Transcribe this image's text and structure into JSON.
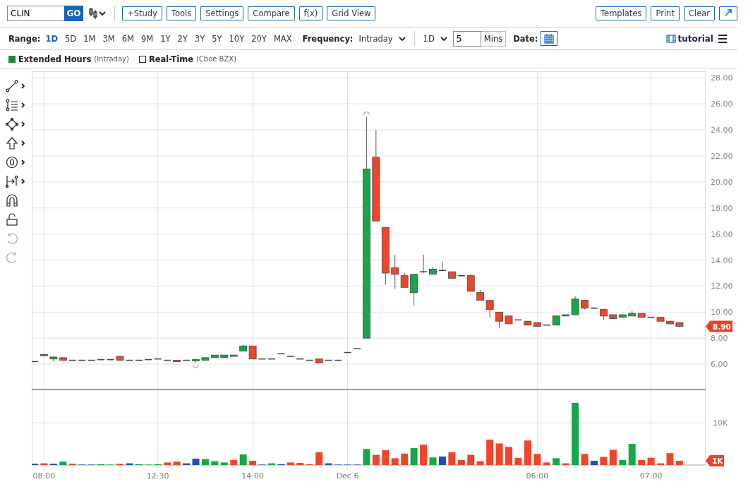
{
  "toolbar": {
    "symbol": "CLIN",
    "go": "GO",
    "buttons_left": [
      "+Study",
      "Tools",
      "Settings",
      "Compare",
      "f(x)",
      "Grid View"
    ],
    "buttons_right": [
      "Templates",
      "Print",
      "Clear"
    ]
  },
  "range": {
    "label": "Range:",
    "items": [
      {
        "label": "1D",
        "selected": true
      },
      {
        "label": "5D",
        "selected": false
      },
      {
        "label": "1M",
        "selected": false
      },
      {
        "label": "3M",
        "selected": false
      },
      {
        "label": "6M",
        "selected": false
      },
      {
        "label": "9M",
        "selected": false
      },
      {
        "label": "1Y",
        "selected": false
      },
      {
        "label": "2Y",
        "selected": false
      },
      {
        "label": "3Y",
        "selected": false
      },
      {
        "label": "5Y",
        "selected": false
      },
      {
        "label": "10Y",
        "selected": false
      },
      {
        "label": "20Y",
        "selected": false
      },
      {
        "label": "MAX",
        "selected": false
      }
    ]
  },
  "frequency": {
    "label": "Frequency:",
    "value": "Intraday"
  },
  "interval": {
    "value": "1D",
    "count": "5",
    "unit": "Mins"
  },
  "date": {
    "label": "Date:"
  },
  "tutorial": "tutorial",
  "legend": [
    {
      "label": "Extended Hours",
      "note": "(Intraday)",
      "checked": true
    },
    {
      "label": "Real-Time",
      "note": "(Cboe BZX)",
      "checked": false
    }
  ],
  "price_chart": {
    "last_price": "8.90",
    "chart_data": {
      "type": "candlestick",
      "grid": true,
      "ohlc": [
        [
          6.2,
          6.2,
          6.2,
          6.2
        ],
        [
          6.65,
          6.8,
          6.6,
          6.75
        ],
        [
          6.4,
          6.6,
          6.2,
          6.55
        ],
        [
          6.5,
          6.5,
          6.3,
          6.3
        ],
        [
          6.3,
          6.3,
          6.3,
          6.3
        ],
        [
          6.3,
          6.3,
          6.3,
          6.3
        ],
        [
          6.3,
          6.3,
          6.3,
          6.3
        ],
        [
          6.3,
          6.4,
          6.3,
          6.35
        ],
        [
          6.35,
          6.4,
          6.3,
          6.35
        ],
        [
          6.6,
          6.6,
          6.3,
          6.3
        ],
        [
          6.3,
          6.3,
          6.3,
          6.3
        ],
        [
          6.3,
          6.3,
          6.3,
          6.3
        ],
        [
          6.35,
          6.35,
          6.35,
          6.35
        ],
        [
          6.4,
          6.4,
          6.4,
          6.4
        ],
        [
          6.3,
          6.3,
          6.3,
          6.3
        ],
        [
          6.3,
          6.3,
          6.2,
          6.2
        ],
        [
          6.3,
          6.3,
          6.3,
          6.3
        ],
        [
          6.25,
          6.4,
          6.1,
          6.35
        ],
        [
          6.3,
          6.5,
          6.3,
          6.5
        ],
        [
          6.5,
          6.7,
          6.5,
          6.7
        ],
        [
          6.5,
          6.7,
          6.5,
          6.7
        ],
        [
          6.6,
          6.7,
          6.6,
          6.7
        ],
        [
          7.0,
          7.5,
          7.0,
          7.4
        ],
        [
          7.4,
          7.4,
          6.4,
          6.4
        ],
        [
          6.4,
          6.4,
          6.4,
          6.4
        ],
        [
          6.4,
          6.4,
          6.4,
          6.4
        ],
        [
          6.8,
          6.8,
          6.8,
          6.8
        ],
        [
          6.6,
          6.6,
          6.6,
          6.6
        ],
        [
          6.4,
          6.4,
          6.4,
          6.4
        ],
        [
          6.3,
          6.3,
          6.3,
          6.3
        ],
        [
          6.4,
          6.4,
          6.1,
          6.1
        ],
        [
          6.3,
          6.3,
          6.3,
          6.3
        ],
        [
          6.3,
          6.3,
          6.3,
          6.3
        ],
        [
          6.9,
          6.9,
          6.9,
          6.9
        ],
        [
          7.2,
          7.2,
          7.2,
          7.2
        ],
        [
          8.0,
          25.0,
          8.0,
          21.0
        ],
        [
          21.9,
          24.0,
          17.0,
          17.0
        ],
        [
          16.5,
          16.5,
          12.1,
          13.0
        ],
        [
          13.4,
          14.4,
          11.8,
          12.9
        ],
        [
          12.8,
          13.0,
          11.9,
          11.9
        ],
        [
          11.5,
          12.9,
          10.5,
          12.9
        ],
        [
          13.1,
          14.4,
          13.0,
          13.1
        ],
        [
          12.9,
          13.5,
          12.9,
          13.3
        ],
        [
          13.2,
          13.9,
          13.2,
          13.2
        ],
        [
          13.1,
          13.1,
          12.6,
          12.6
        ],
        [
          12.8,
          12.8,
          12.7,
          12.8
        ],
        [
          12.8,
          12.9,
          11.6,
          11.6
        ],
        [
          11.5,
          11.7,
          10.9,
          10.9
        ],
        [
          10.9,
          10.9,
          9.6,
          10.2
        ],
        [
          10.0,
          10.0,
          8.8,
          9.3
        ],
        [
          9.7,
          9.7,
          9.1,
          9.1
        ],
        [
          9.4,
          9.4,
          9.4,
          9.4
        ],
        [
          9.3,
          9.3,
          9.0,
          9.0
        ],
        [
          9.2,
          9.2,
          8.9,
          8.9
        ],
        [
          9.0,
          9.0,
          9.0,
          9.0
        ],
        [
          9.0,
          9.7,
          9.0,
          9.7
        ],
        [
          9.7,
          9.8,
          9.7,
          9.8
        ],
        [
          9.8,
          11.2,
          9.8,
          11.0
        ],
        [
          10.9,
          10.9,
          10.2,
          10.3
        ],
        [
          10.3,
          10.4,
          10.3,
          10.3
        ],
        [
          10.2,
          10.2,
          9.4,
          9.7
        ],
        [
          9.8,
          9.8,
          9.5,
          9.5
        ],
        [
          9.6,
          9.8,
          9.6,
          9.8
        ],
        [
          9.7,
          10.1,
          9.7,
          9.9
        ],
        [
          9.9,
          9.9,
          9.6,
          9.6
        ],
        [
          9.6,
          9.6,
          9.6,
          9.6
        ],
        [
          9.6,
          9.6,
          9.3,
          9.3
        ],
        [
          9.3,
          9.3,
          9.0,
          9.1
        ],
        [
          9.2,
          9.2,
          8.9,
          8.9
        ]
      ],
      "ylim": [
        4,
        28.5
      ],
      "yticks": [
        {
          "value": 28,
          "label": "28.00"
        },
        {
          "value": 26,
          "label": "26.00"
        },
        {
          "value": 24,
          "label": "24.00"
        },
        {
          "value": 22,
          "label": "22.00"
        },
        {
          "value": 20,
          "label": "20.00"
        },
        {
          "value": 18,
          "label": "18.00"
        },
        {
          "value": 16,
          "label": "16.00"
        },
        {
          "value": 14,
          "label": "14.00"
        },
        {
          "value": 12,
          "label": "12.00"
        },
        {
          "value": 10,
          "label": "10.00"
        },
        {
          "value": 8,
          "label": "8.00"
        },
        {
          "value": 6,
          "label": "6.00"
        }
      ]
    }
  },
  "volume_chart": {
    "badge": "1K",
    "chart_data": {
      "type": "bar",
      "grid": true,
      "categories": [
        null,
        "08:00",
        null,
        null,
        null,
        null,
        null,
        null,
        null,
        null,
        null,
        null,
        null,
        "12:30",
        null,
        null,
        null,
        null,
        null,
        null,
        null,
        null,
        null,
        "14:00",
        null,
        null,
        null,
        null,
        null,
        null,
        null,
        null,
        null,
        "Dec 6",
        null,
        null,
        null,
        null,
        null,
        null,
        null,
        null,
        null,
        null,
        null,
        null,
        null,
        null,
        null,
        null,
        null,
        null,
        null,
        "06:00",
        null,
        null,
        null,
        null,
        null,
        null,
        null,
        null,
        null,
        null,
        null,
        "07:00",
        null,
        null,
        null
      ],
      "series": [
        {
          "color": "#14a84b",
          "values": [
            null,
            null,
            null,
            800,
            null,
            null,
            null,
            200,
            100,
            null,
            null,
            200,
            100,
            200,
            null,
            null,
            null,
            null,
            1400,
            900,
            600,
            null,
            2500,
            null,
            null,
            400,
            null,
            null,
            null,
            null,
            null,
            null,
            null,
            null,
            null,
            3800,
            null,
            null,
            null,
            null,
            4000,
            null,
            1800,
            null,
            null,
            null,
            null,
            null,
            null,
            null,
            null,
            null,
            null,
            null,
            null,
            1600,
            null,
            14700,
            null,
            null,
            null,
            null,
            1200,
            5000,
            null,
            null,
            null,
            null,
            null
          ]
        },
        {
          "color": "#f0452a",
          "values": [
            null,
            400,
            null,
            null,
            300,
            null,
            null,
            null,
            null,
            300,
            null,
            null,
            null,
            null,
            600,
            800,
            null,
            null,
            null,
            null,
            null,
            1200,
            null,
            1000,
            null,
            null,
            null,
            600,
            500,
            200,
            3000,
            null,
            null,
            null,
            null,
            null,
            2400,
            3500,
            1600,
            2700,
            null,
            4800,
            null,
            null,
            3000,
            1200,
            2400,
            900,
            6000,
            5100,
            4300,
            1700,
            5800,
            2600,
            600,
            null,
            400,
            null,
            2600,
            null,
            1900,
            3600,
            null,
            null,
            1200,
            1700,
            400,
            2800,
            1000
          ]
        },
        {
          "color": "#1f4fbf",
          "values": [
            300,
            null,
            300,
            null,
            null,
            100,
            100,
            null,
            null,
            null,
            400,
            null,
            null,
            null,
            null,
            null,
            400,
            1500,
            null,
            null,
            null,
            null,
            null,
            null,
            100,
            null,
            200,
            null,
            null,
            null,
            null,
            400,
            100,
            100,
            100,
            null,
            null,
            null,
            null,
            null,
            null,
            null,
            null,
            2000,
            null,
            null,
            null,
            null,
            null,
            null,
            null,
            null,
            null,
            null,
            null,
            null,
            null,
            null,
            null,
            1000,
            null,
            null,
            null,
            null,
            null,
            null,
            null,
            null,
            null
          ]
        }
      ],
      "ylim": [
        0,
        17700
      ],
      "yticks": [
        {
          "value": 10000,
          "label": "10K"
        }
      ]
    }
  }
}
